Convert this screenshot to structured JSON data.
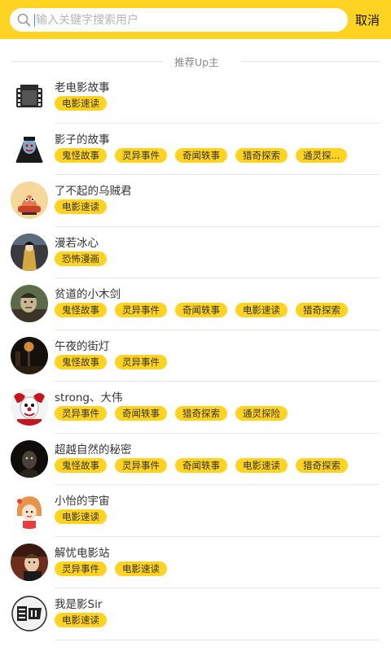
{
  "search": {
    "placeholder": "输入关键字搜索用户",
    "cancel_label": "取消"
  },
  "section": {
    "title": "推荐Up主"
  },
  "colors": {
    "accent": "#FFD321",
    "text": "#333333",
    "divider": "#E6E6E6"
  },
  "users": [
    {
      "name": "老电影故事",
      "avatar_icon": "film-reel-icon",
      "tags": [
        "电影速读"
      ]
    },
    {
      "name": "影子的故事",
      "avatar_icon": "vampire-cartoon-icon",
      "tags": [
        "鬼怪故事",
        "灵异事件",
        "奇闻轶事",
        "猎奇探索",
        "通灵探..."
      ]
    },
    {
      "name": "了不起的乌贼君",
      "avatar_icon": "squid-cartoon-icon",
      "tags": [
        "电影速读"
      ]
    },
    {
      "name": "漫若冰心",
      "avatar_icon": "dark-figure-icon",
      "tags": [
        "恐怖漫画"
      ]
    },
    {
      "name": "贫道的小木剑",
      "avatar_icon": "taoist-portrait-icon",
      "tags": [
        "鬼怪故事",
        "灵异事件",
        "奇闻轶事",
        "电影速读",
        "猎奇探索"
      ]
    },
    {
      "name": "午夜的街灯",
      "avatar_icon": "night-street-icon",
      "tags": [
        "鬼怪故事",
        "灵异事件"
      ]
    },
    {
      "name": "strong、大伟",
      "avatar_icon": "clown-icon",
      "tags": [
        "灵异事件",
        "奇闻轶事",
        "猎奇探索",
        "通灵探险"
      ]
    },
    {
      "name": "超越自然的秘密",
      "avatar_icon": "ghost-face-icon",
      "tags": [
        "鬼怪故事",
        "灵异事件",
        "奇闻轶事",
        "电影速读",
        "猎奇探索"
      ]
    },
    {
      "name": "小怡的宇宙",
      "avatar_icon": "cartoon-girl-icon",
      "tags": [
        "电影速读"
      ]
    },
    {
      "name": "解忧电影站",
      "avatar_icon": "movie-character-icon",
      "tags": [
        "灵异事件",
        "电影速读"
      ]
    },
    {
      "name": "我是影Sir",
      "avatar_icon": "ying-sir-logo-icon",
      "tags": [
        "电影速读"
      ]
    }
  ]
}
